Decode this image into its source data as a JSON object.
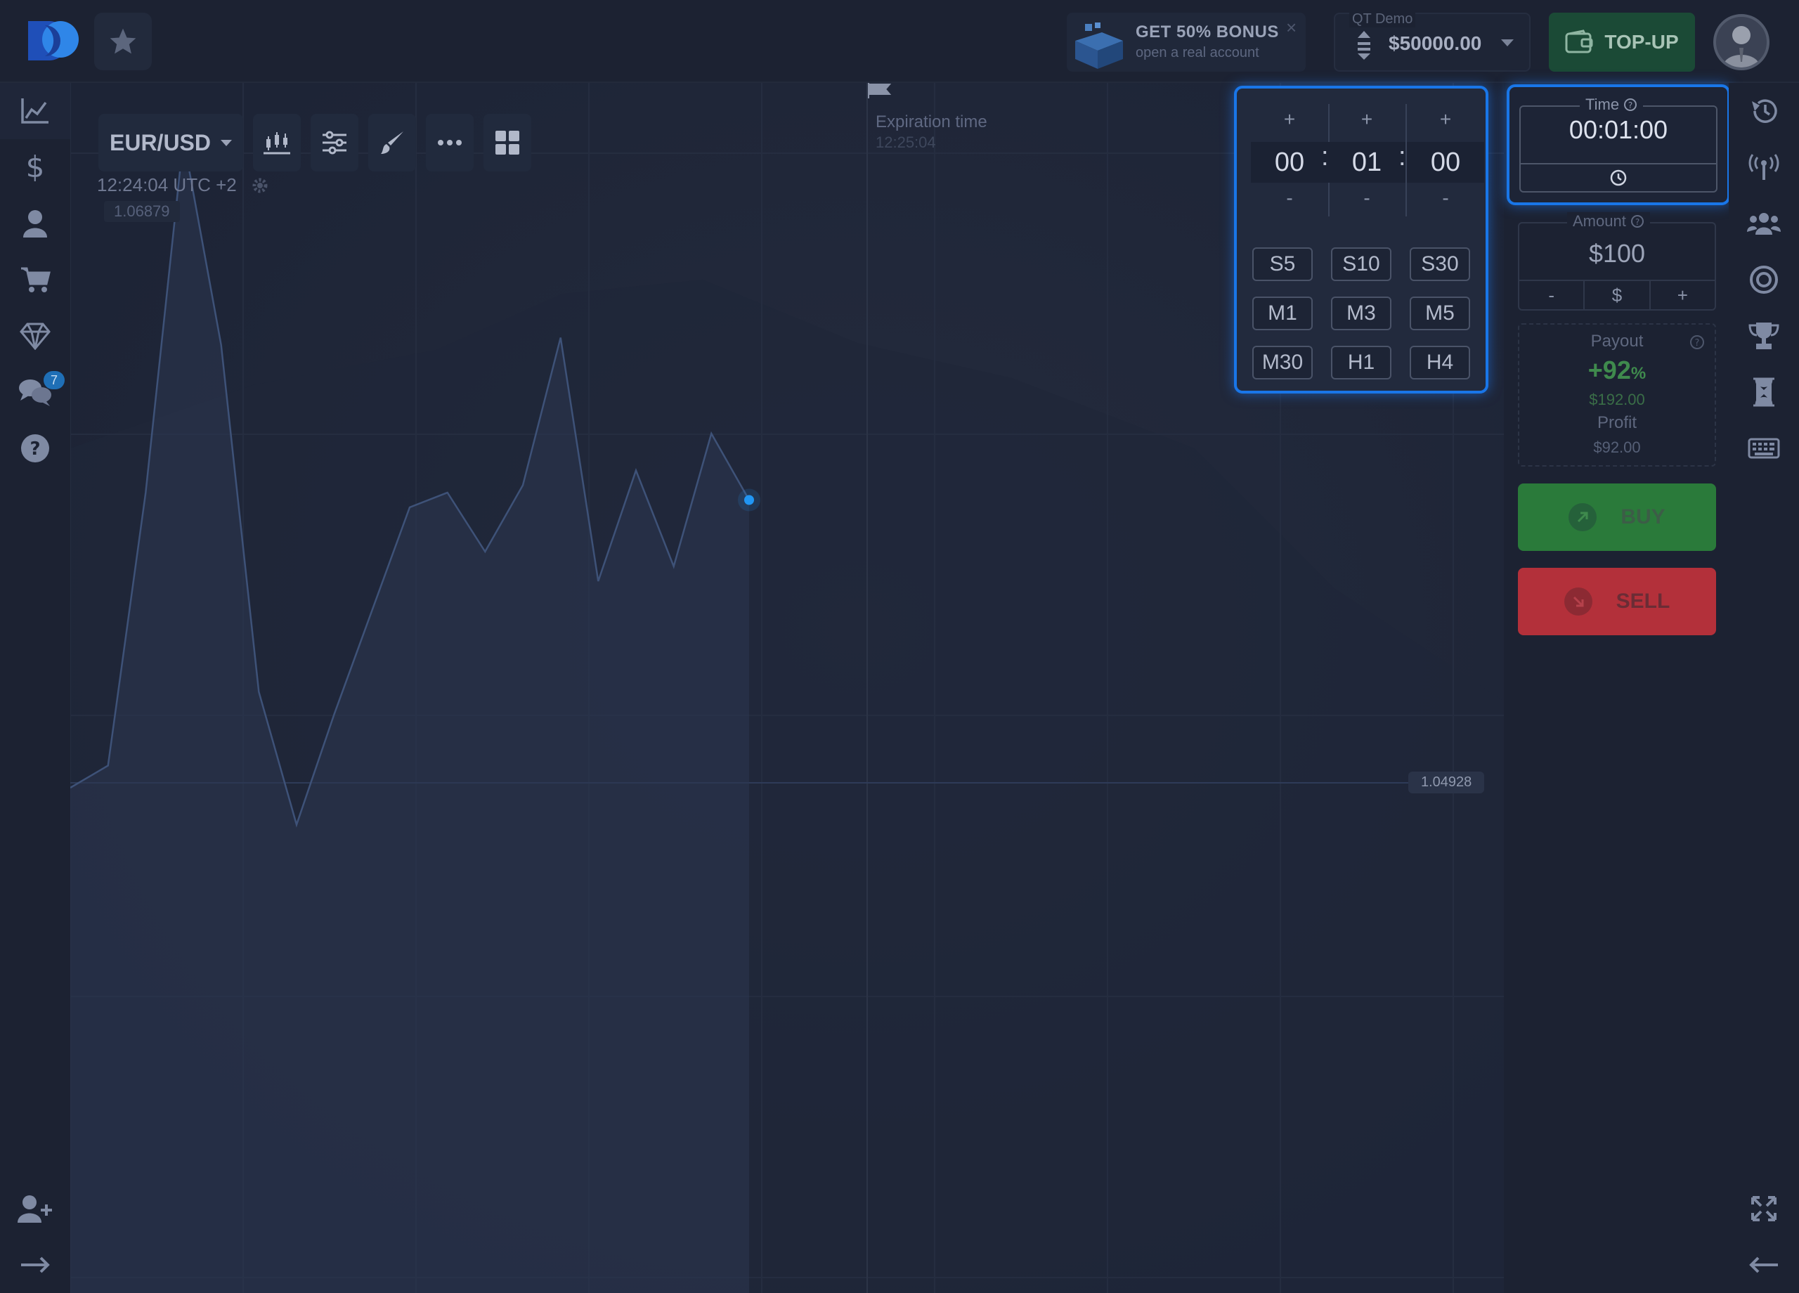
{
  "header": {
    "bonus": {
      "title": "GET 50% BONUS",
      "subtitle": "open a real account",
      "close": "×"
    },
    "account": {
      "label": "QT Demo",
      "balance": "$50000.00"
    },
    "topup_label": "TOP-UP"
  },
  "left_sidebar": {
    "items": [
      "trading-chart-icon",
      "finance-dollar-icon",
      "profile-user-icon",
      "market-cart-icon",
      "achievements-diamond-icon",
      "chat-icon",
      "help-icon"
    ],
    "chat_badge": "7",
    "bottom_items": [
      "add-friend-icon",
      "expand-sidebar-arrow-icon"
    ]
  },
  "right_sidebar": {
    "items": [
      "trades-history-icon",
      "signals-icon",
      "social-trading-icon",
      "express-trades-icon",
      "tournaments-icon",
      "pending-trades-icon",
      "hotkeys-icon"
    ],
    "bottom_items": [
      "fullscreen-icon",
      "collapse-panel-arrow-icon"
    ]
  },
  "chart": {
    "pair": "EUR/USD",
    "timestamp": "12:24:04 UTC +2",
    "high_label": "1.06879",
    "current_price_label": "1.04928",
    "expiration_label": "Expiration time",
    "expiration_time": "12:25:04",
    "accent_color": "#2196f3"
  },
  "chart_data": {
    "type": "area",
    "series": [
      {
        "values": [
          1.0,
          1.3,
          5.0,
          9.8,
          7.0,
          2.3,
          0.5,
          2.0,
          3.4,
          4.8,
          5.0,
          4.2,
          5.1,
          7.1,
          3.8,
          5.3,
          4.0,
          5.8,
          4.9
        ]
      }
    ],
    "grid": true
  },
  "time_picker": {
    "hours": "00",
    "minutes": "01",
    "seconds": "00",
    "plus": "+",
    "minus": "-",
    "sep": ":",
    "presets": [
      "S5",
      "S10",
      "S30",
      "M1",
      "M3",
      "M5",
      "M30",
      "H1",
      "H4"
    ]
  },
  "trade_panel": {
    "time_label": "Time",
    "time_value": "00:01:00",
    "amount_label": "Amount",
    "amount_value": "$100",
    "amount_minus": "-",
    "amount_currency": "$",
    "amount_plus": "+",
    "payout_label": "Payout",
    "payout_percent": "+92",
    "payout_percent_sign": "%",
    "payout_total": "$192.00",
    "profit_label": "Profit",
    "profit_value": "$92.00",
    "buy_label": "BUY",
    "sell_label": "SELL"
  }
}
